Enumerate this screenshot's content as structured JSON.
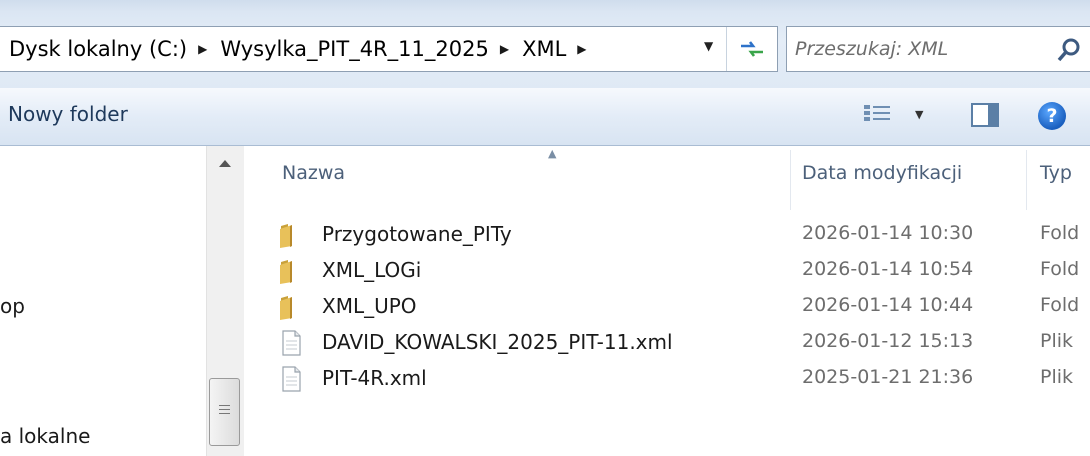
{
  "address_bar": {
    "breadcrumbs": [
      "Dysk lokalny (C:)",
      "Wysylka_PIT_4R_11_2025",
      "XML"
    ],
    "refresh_icon": "refresh-arrows-icon",
    "dropdown_icon": "chevron-down-icon"
  },
  "search": {
    "placeholder": "Przeszukaj: XML",
    "icon": "search-icon"
  },
  "toolbar": {
    "new_folder_label": "Nowy folder",
    "view_icon": "details-view-icon",
    "preview_icon": "preview-pane-icon",
    "help_label": "?"
  },
  "nav_pane": {
    "items": [
      {
        "label": "op"
      },
      {
        "label": "a lokalne"
      }
    ]
  },
  "columns": {
    "name": "Nazwa",
    "date": "Data modyfikacji",
    "type": "Typ"
  },
  "files": [
    {
      "name": "Przygotowane_PITy",
      "date": "2026-01-14 10:30",
      "type": "Fold",
      "icon": "folder-icon"
    },
    {
      "name": "XML_LOGi",
      "date": "2026-01-14 10:54",
      "type": "Fold",
      "icon": "folder-icon"
    },
    {
      "name": "XML_UPO",
      "date": "2026-01-14 10:44",
      "type": "Fold",
      "icon": "folder-icon"
    },
    {
      "name": "DAVID_KOWALSKI_2025_PIT-11.xml",
      "date": "2026-01-12 15:13",
      "type": "Plik",
      "icon": "file-icon"
    },
    {
      "name": "PIT-4R.xml",
      "date": "2025-01-21 21:36",
      "type": "Plik",
      "icon": "file-icon"
    }
  ]
}
